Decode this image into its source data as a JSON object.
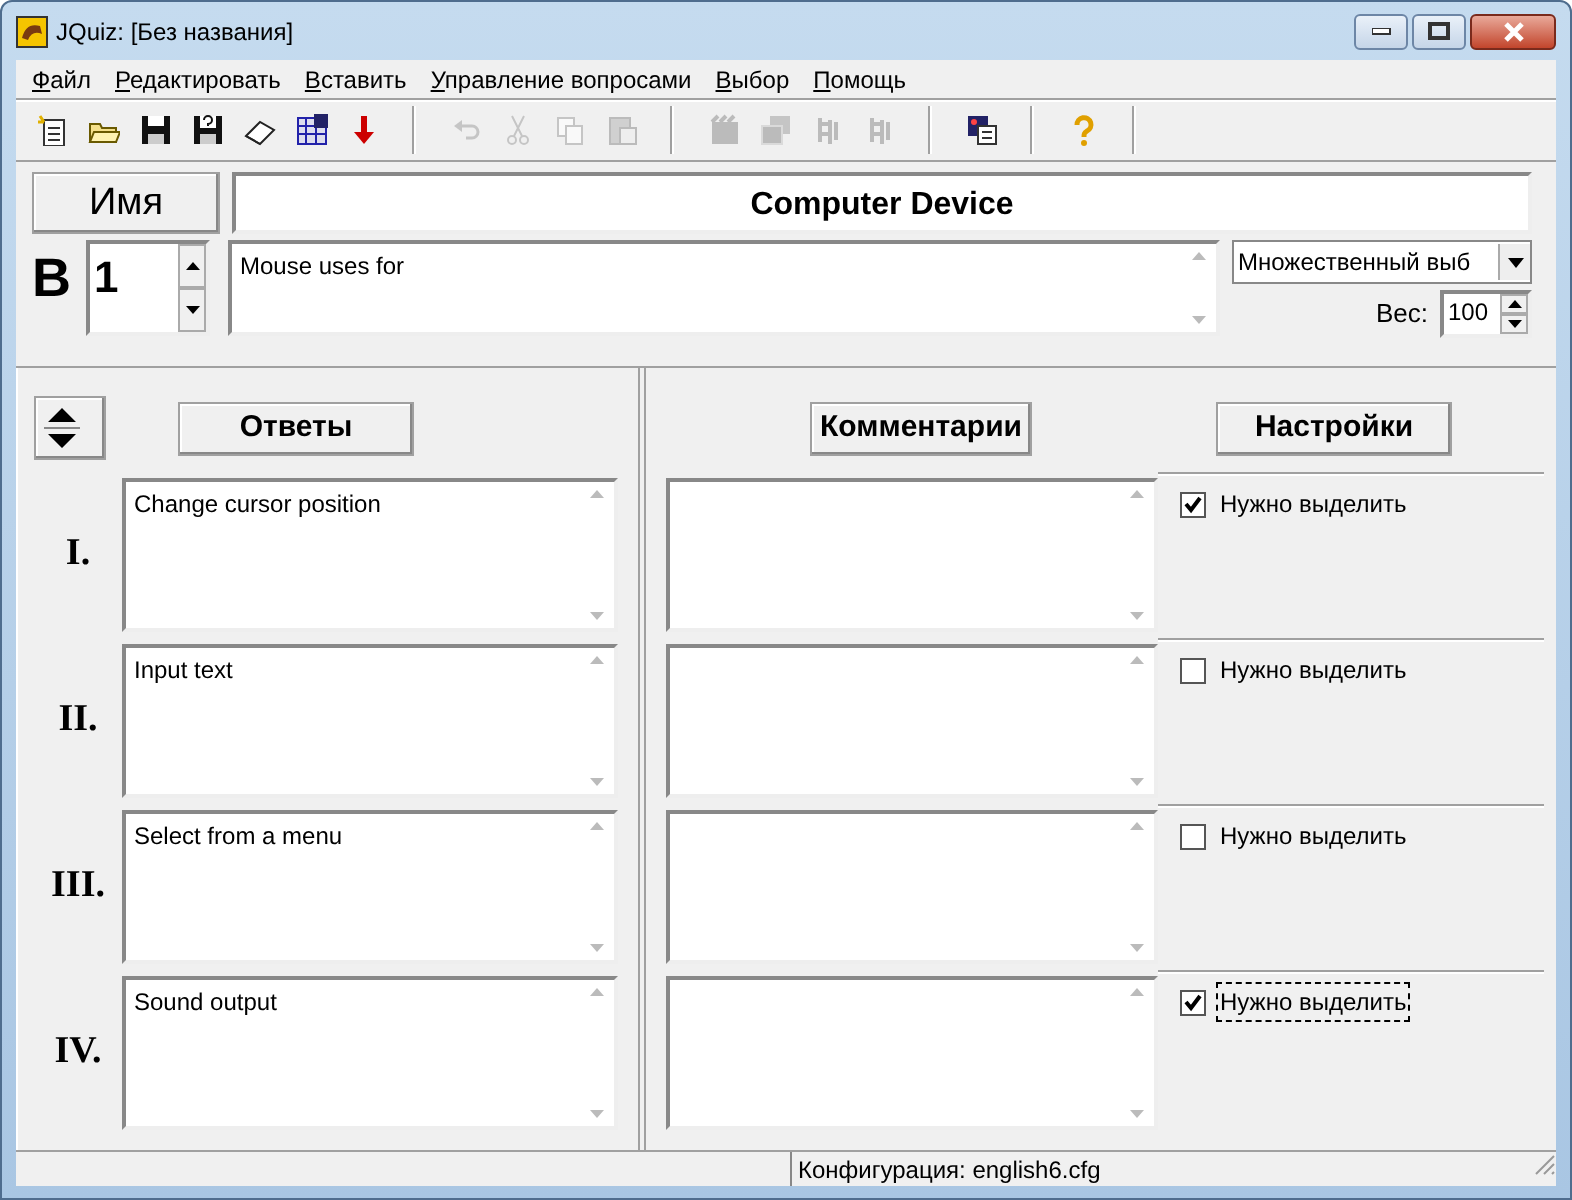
{
  "window": {
    "title": "JQuiz: [Без названия]"
  },
  "menu": [
    {
      "label": "Файл"
    },
    {
      "label": "Редактировать"
    },
    {
      "label": "Вставить"
    },
    {
      "label": "Управление вопросами"
    },
    {
      "label": "Выбор"
    },
    {
      "label": "Помощь"
    }
  ],
  "toolbar": [
    {
      "kind": "new",
      "disabled": false
    },
    {
      "kind": "open",
      "disabled": false
    },
    {
      "kind": "save",
      "disabled": false
    },
    {
      "kind": "saveas",
      "disabled": false
    },
    {
      "kind": "eraser",
      "disabled": false
    },
    {
      "kind": "web",
      "disabled": false
    },
    {
      "kind": "down",
      "disabled": false
    },
    {
      "kind": "separator"
    },
    {
      "kind": "undo",
      "disabled": true
    },
    {
      "kind": "cut",
      "disabled": true
    },
    {
      "kind": "copy",
      "disabled": true
    },
    {
      "kind": "paste",
      "disabled": true
    },
    {
      "kind": "separator"
    },
    {
      "kind": "film",
      "disabled": true
    },
    {
      "kind": "stack",
      "disabled": true
    },
    {
      "kind": "tree",
      "disabled": true
    },
    {
      "kind": "tree",
      "disabled": true
    },
    {
      "kind": "separator"
    },
    {
      "kind": "export",
      "disabled": false
    },
    {
      "kind": "separator"
    },
    {
      "kind": "help",
      "disabled": false
    },
    {
      "kind": "separator"
    }
  ],
  "name_button": "Имя",
  "quiz_title": "Computer Device",
  "question_label": "В",
  "question_number": "1",
  "question_text": "Mouse uses for",
  "question_type": "Множественный выб",
  "weight_label": "Вес:",
  "weight": "100",
  "answers_header": "Ответы",
  "comments_header": "Комментарии",
  "settings_header": "Настройки",
  "answers": [
    {
      "numeral": "I.",
      "text": "Change cursor position",
      "option": "Нужно выделить",
      "checked": true,
      "focused": false
    },
    {
      "numeral": "II.",
      "text": "Input text",
      "option": "Нужно выделить",
      "checked": false,
      "focused": false
    },
    {
      "numeral": "III.",
      "text": "Select from a menu",
      "option": "Нужно выделить",
      "checked": false,
      "focused": false
    },
    {
      "numeral": "IV.",
      "text": "Sound output",
      "option": "Нужно выделить",
      "checked": true,
      "focused": true
    }
  ],
  "status_bar": "Конфигурация: english6.cfg"
}
